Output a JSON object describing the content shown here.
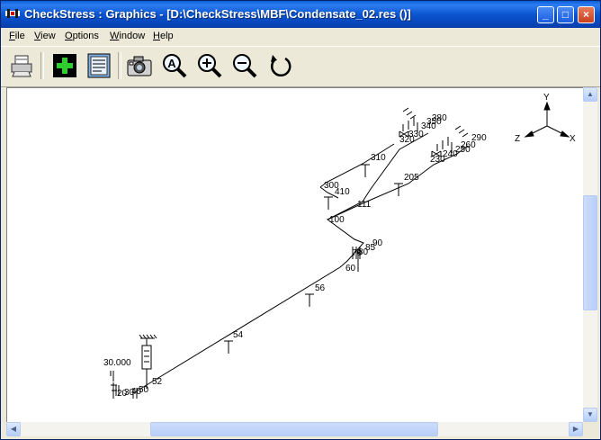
{
  "window": {
    "title": "CheckStress : Graphics -  [D:\\CheckStress\\MBF\\Condensate_02.res ()]",
    "controls": {
      "minimize": "_",
      "maximize": "□",
      "close": "×"
    }
  },
  "menu": {
    "items": [
      {
        "label": "File",
        "accel": "F",
        "rest": "ile"
      },
      {
        "label": "View",
        "accel": "V",
        "rest": "iew"
      },
      {
        "label": "Options",
        "accel": "O",
        "rest": "ptions"
      },
      {
        "label": "Window",
        "accel": "W",
        "rest": "indow"
      },
      {
        "label": "Help",
        "accel": "H",
        "rest": "elp"
      }
    ]
  },
  "toolbar": {
    "buttons": [
      {
        "name": "print-icon"
      },
      {
        "name": "add-green-cross-icon"
      },
      {
        "name": "report-document-icon"
      },
      {
        "name": "camera-icon"
      },
      {
        "name": "zoom-all-icon",
        "glyph": "A"
      },
      {
        "name": "zoom-in-icon",
        "glyph": "+"
      },
      {
        "name": "zoom-out-icon",
        "glyph": "−"
      },
      {
        "name": "rotate-icon"
      }
    ]
  },
  "graphics": {
    "axes": {
      "y": "Y",
      "z": "Z",
      "x": "X"
    },
    "node_labels": {
      "n310": "310",
      "n205": "205",
      "n300": "300",
      "n410": "410",
      "n111": "111",
      "n100": "100",
      "n90": "90",
      "n85": "85",
      "n80": "80",
      "n70": "70",
      "n60": "60",
      "n56": "56",
      "n54": "54",
      "n52": "52",
      "n50": "50",
      "n40": "40",
      "n30": "30",
      "n20": "20",
      "n380": "380",
      "n350": "350",
      "n340": "340",
      "n330": "330",
      "n320": "320",
      "n290": "290",
      "n260": "260",
      "n250": "250",
      "n240": "240",
      "n230": "230"
    },
    "load_value": "30.000"
  },
  "colors": {
    "titlebar": "#0a55d0",
    "pipe": "#000000"
  }
}
